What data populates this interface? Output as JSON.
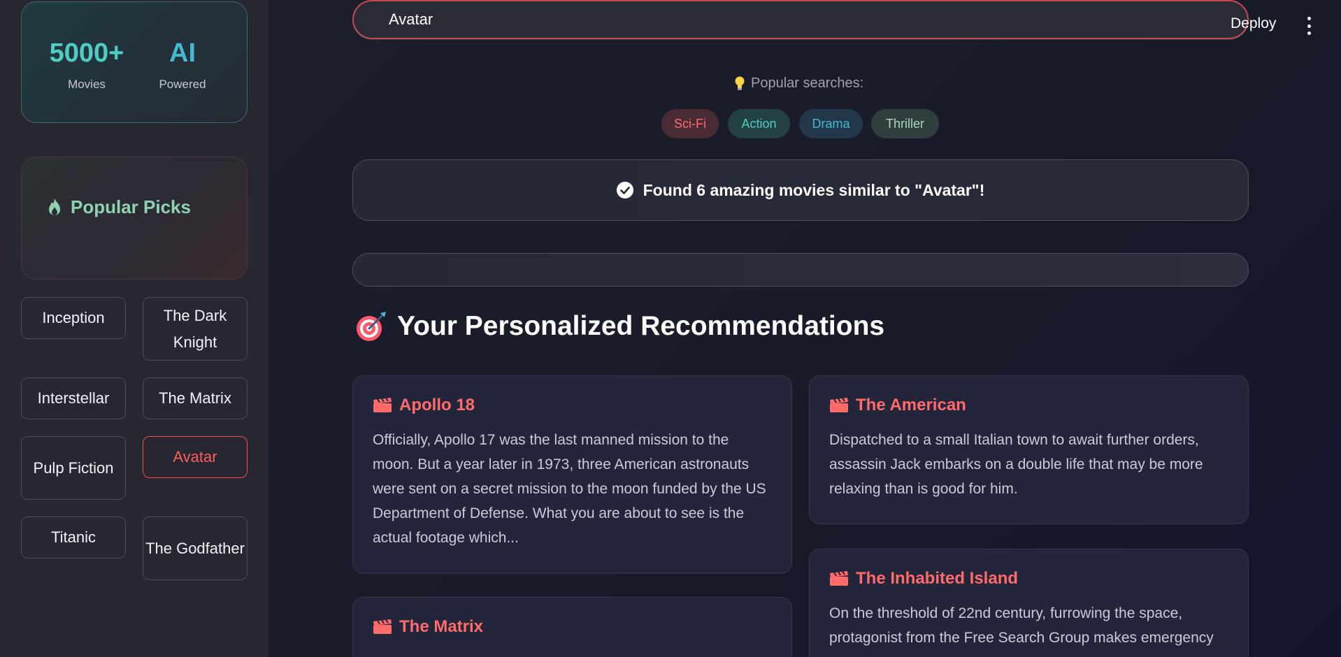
{
  "sidebar": {
    "stats": [
      {
        "value": "5000+",
        "label": "Movies"
      },
      {
        "value": "AI",
        "label": "Powered"
      }
    ],
    "popular_picks_title": "Popular Picks",
    "movies": [
      "Inception",
      "The Dark Knight",
      "Interstellar",
      "The Matrix",
      "Pulp Fiction",
      "Avatar",
      "Titanic",
      "The Godfather"
    ],
    "selected_movie": "Avatar"
  },
  "header": {
    "deploy_label": "Deploy",
    "menu_icon": "kebab-menu-icon"
  },
  "search": {
    "value": "Avatar"
  },
  "popular_searches": {
    "label": "Popular searches:",
    "icon": "lightbulb-icon",
    "chips": [
      "Sci-Fi",
      "Action",
      "Drama",
      "Thriller"
    ]
  },
  "result_banner": {
    "text": "Found 6 amazing movies similar to \"Avatar\"!",
    "icon": "check-circle-icon"
  },
  "recommendations": {
    "heading": "Your Personalized Recommendations",
    "heading_icon": "target-icon",
    "cards": [
      {
        "title": "Apollo 18",
        "description": "Officially, Apollo 17 was the last manned mission to the moon. But a year later in 1973, three American astronauts were sent on a secret mission to the moon funded by the US Department of Defense. What you are about to see is the actual footage which..."
      },
      {
        "title": "The American",
        "description": "Dispatched to a small Italian town to await further orders, assassin Jack embarks on a double life that may be more relaxing than is good for him."
      },
      {
        "title": "The Matrix",
        "description": ""
      },
      {
        "title": "The Inhabited Island",
        "description": "On the threshold of 22nd century, furrowing the space, protagonist from the Free Search Group makes emergency"
      }
    ]
  },
  "colors": {
    "accent_red": "#ff6b6b",
    "accent_teal": "#4ecdc4",
    "accent_blue": "#45b7d1",
    "accent_mint": "#a8d8b8",
    "search_border": "#c74a52"
  }
}
